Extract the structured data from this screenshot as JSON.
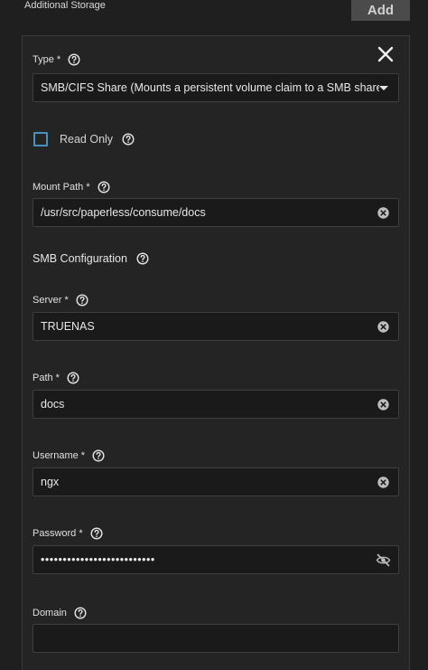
{
  "section": {
    "title": "Additional Storage",
    "add_label": "Add"
  },
  "type_field": {
    "label": "Type *",
    "value": "SMB/CIFS Share (Mounts a persistent volume claim to a SMB share)"
  },
  "read_only": {
    "label": "Read Only",
    "checked": false
  },
  "mount_path": {
    "label": "Mount Path *",
    "value": "/usr/src/paperless/consume/docs"
  },
  "smb": {
    "title": "SMB Configuration"
  },
  "server": {
    "label": "Server *",
    "value": "TRUENAS"
  },
  "path": {
    "label": "Path *",
    "value": "docs"
  },
  "username": {
    "label": "Username *",
    "value": "ngx"
  },
  "password": {
    "label": "Password *",
    "value": "••••••••••••••••••••••••••"
  },
  "domain": {
    "label": "Domain",
    "value": ""
  },
  "colors": {
    "background": "#1f1f1f",
    "card": "#242424",
    "checkbox_accent": "#4a8fc2",
    "add_button": "#4b4b4b"
  },
  "icons": [
    "close-icon",
    "help-icon",
    "clear-icon",
    "dropdown-caret-icon",
    "visibility-off-icon"
  ]
}
